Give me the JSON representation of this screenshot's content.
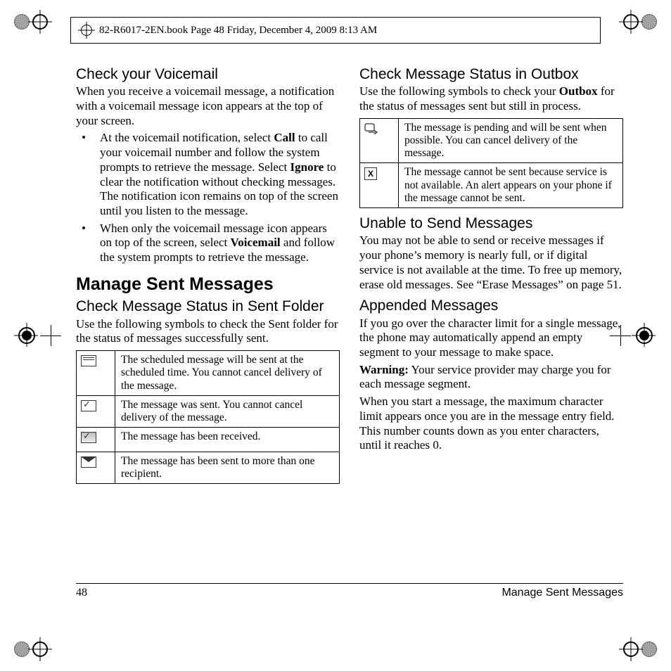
{
  "header_line": "82-R6017-2EN.book  Page 48  Friday, December 4, 2009  8:13 AM",
  "footer": {
    "page": "48",
    "section": "Manage Sent Messages"
  },
  "left": {
    "h_voicemail": "Check your Voicemail",
    "p_voicemail": "When you receive a voicemail message, a notification with a voicemail message icon appears at the top of your screen.",
    "bullets": [
      "At the voicemail notification, select <b>Call</b> to call your voicemail number and follow the system prompts to retrieve the message. Select <b>Ignore</b> to clear the notification without checking messages. The notification icon remains on top of the screen until you listen to the message.",
      "When only the voicemail message icon appears on top of the screen, select <b>Voicemail</b> and follow the system prompts to retrieve the message."
    ],
    "h_manage": "Manage Sent Messages",
    "h_sent_folder": "Check Message Status in Sent Folder",
    "p_sent_folder": "Use the following symbols to check the Sent folder for the status of messages successfully sent.",
    "sent_table": [
      {
        "icon": "sched",
        "text": "The scheduled message will be sent at the scheduled time. You cannot cancel delivery of the message."
      },
      {
        "icon": "sent",
        "text": "The message was sent. You cannot cancel delivery of the message."
      },
      {
        "icon": "recv",
        "text": "The message has been received."
      },
      {
        "icon": "multi",
        "text": "The message has been sent to more than one recipient."
      }
    ]
  },
  "right": {
    "h_outbox": "Check Message Status in Outbox",
    "p_outbox": "Use the following symbols to check your <b>Outbox</b> for the status of messages sent but still in process.",
    "outbox_table": [
      {
        "icon": "pending",
        "text": "The message is pending and will be sent when possible. You can cancel delivery of the message."
      },
      {
        "icon": "fail",
        "glyph_text": "X",
        "text": "The message cannot be sent because service is not available. An alert appears on your phone if the message cannot be sent."
      }
    ],
    "h_unable": "Unable to Send Messages",
    "p_unable": "You may not be able to send or receive messages if your phone’s memory is nearly full, or if digital service is not available at the time. To free up memory, erase old messages. See “Erase Messages” on page 51.",
    "h_appended": "Appended Messages",
    "p_appended1": "If you go over the character limit for a single message, the phone may automatically append an empty segment to your message to make space.",
    "p_appended2": "<b>Warning:</b> Your service provider may charge you for each message segment.",
    "p_appended3": "When you start a message, the maximum character limit appears once you are in the message entry field. This number counts down as you enter characters, until it reaches 0."
  }
}
